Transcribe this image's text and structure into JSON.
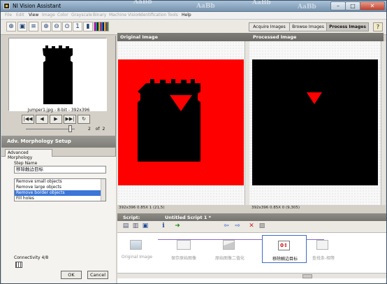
{
  "window": {
    "title": "NI Vision Assistant",
    "decorative_text": "AaBb"
  },
  "menu": [
    "File",
    "Edit",
    "View",
    "Image",
    "Color",
    "Grayscale",
    "Binary",
    "Machine Vision",
    "Identification",
    "Tools",
    "Help"
  ],
  "menu_enabled": [
    false,
    false,
    true,
    false,
    false,
    false,
    false,
    false,
    false,
    false,
    true
  ],
  "toolbar": {
    "tabs": [
      "Acquire Images",
      "Browse Images",
      "Process Images"
    ],
    "active_tab": "Process Images",
    "help": "?"
  },
  "thumbnail": {
    "caption": "Jumper1.jpg - 8-bit - 392x396"
  },
  "navigation": {
    "buttons": [
      "|◀◀",
      "◀",
      "▶",
      "▶▶|",
      "↻"
    ],
    "current": "2",
    "of_label": "of",
    "total": "2"
  },
  "setup": {
    "title": "Adv. Morphology Setup",
    "tab": "Advanced Morphology",
    "step_name_label": "Step Name",
    "step_name_value": "移除触边目标",
    "functions": [
      "Remove small objects",
      "Remove large objects",
      "Remove border objects",
      "Fill holes"
    ],
    "selected_function": "Remove border objects",
    "connectivity_label": "Connectivity 4/8",
    "ok": "OK",
    "cancel": "Cancel"
  },
  "viewers": {
    "original_title": "Original Image",
    "processed_title": "Processed Image",
    "original_status": "392x396 0.85X 1      (21,5)",
    "processed_status": "392x396 0.85X 0      (9,305)"
  },
  "script": {
    "label": "Script:",
    "name": "Untitled Script 1 *",
    "steps": [
      "Original Image",
      "保存原始图像",
      "原始图像二值化",
      "移除触边目标",
      "查找条-相等"
    ],
    "selected_step": "移除触边目标"
  },
  "colors": {
    "original_background": "#ff0000",
    "processed_background": "#000000",
    "selection": "#3b76d8"
  }
}
